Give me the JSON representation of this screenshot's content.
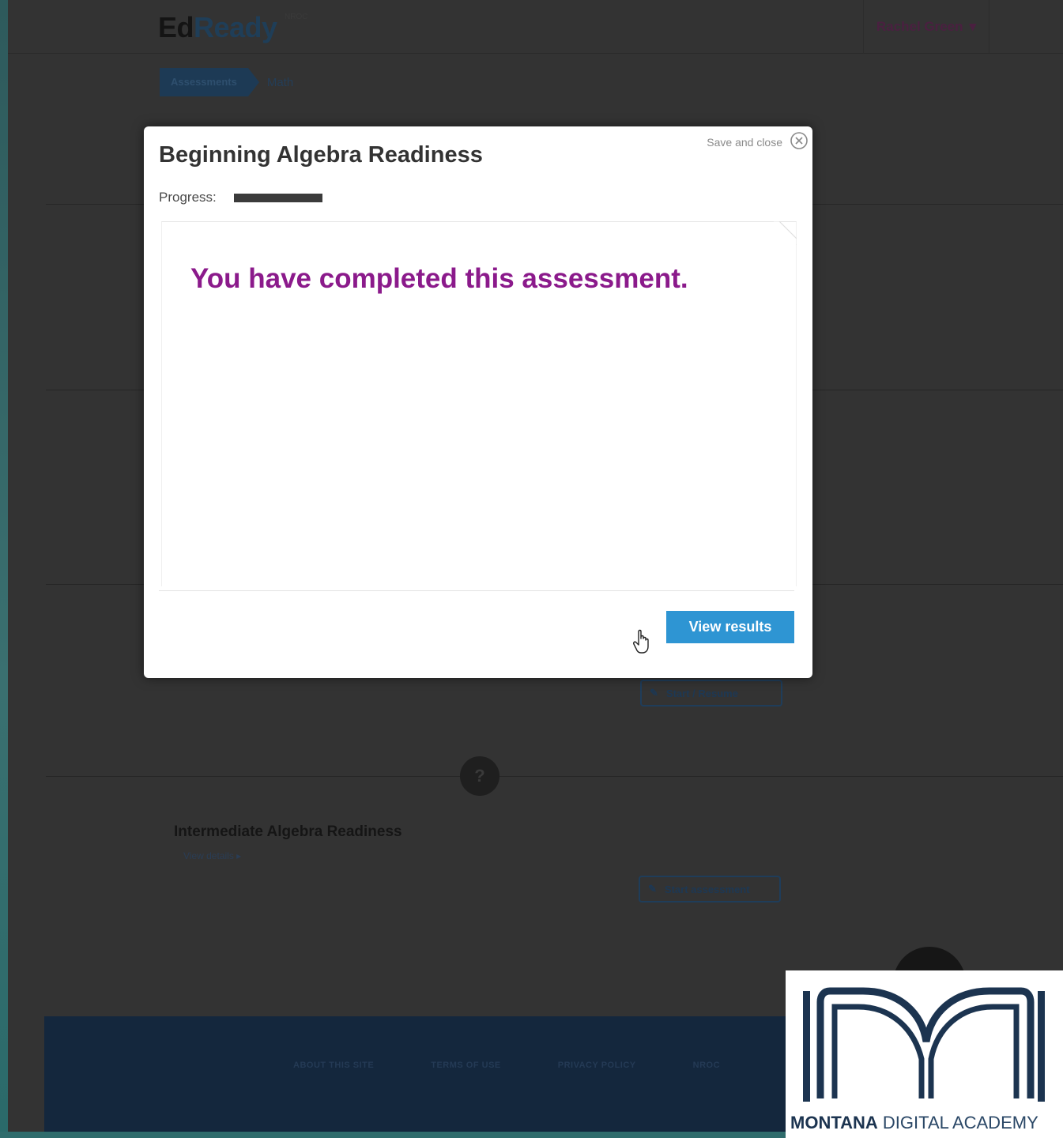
{
  "app": {
    "brand_ed": "Ed",
    "brand_ready": "Ready",
    "brand_sub": "NROC",
    "user_name": "Rachel Green"
  },
  "breadcrumb": {
    "current": "Assessments",
    "next": "Math"
  },
  "background": {
    "section_button_1": "Start / Resume",
    "help_glyph": "?",
    "next_assessment_title": "Intermediate Algebra Readiness",
    "next_assessment_link": "View details",
    "section_button_2": "Start assessment",
    "footer_links": [
      "ABOUT THIS SITE",
      "TERMS OF USE",
      "PRIVACY POLICY",
      "NROC"
    ]
  },
  "modal": {
    "title": "Beginning Algebra Readiness",
    "save_close": "Save and close",
    "progress_label": "Progress:",
    "progress_value": 1.0,
    "message": "You have completed this assessment.",
    "view_results": "View results"
  },
  "logo": {
    "text_bold": "MONTANA",
    "text_light": "DIGITAL ACADEMY"
  },
  "colors": {
    "message": "#8b1a8b",
    "button": "#2e95d3",
    "logo_navy": "#1c3450"
  }
}
